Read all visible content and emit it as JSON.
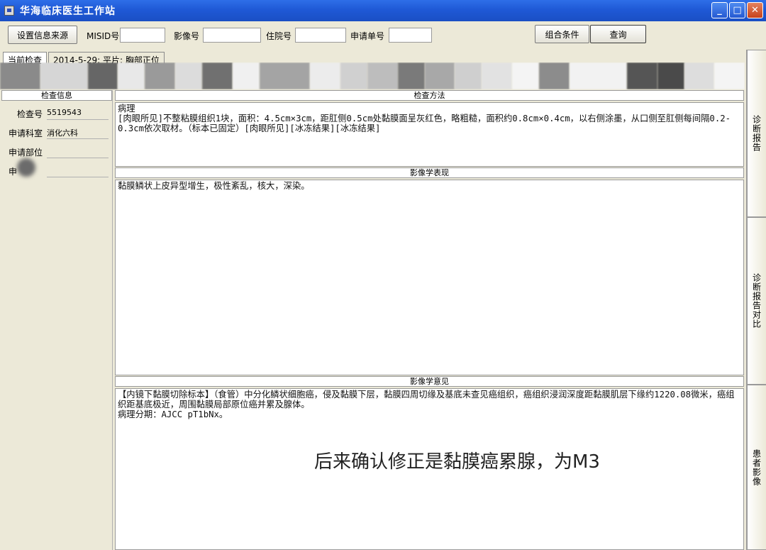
{
  "window": {
    "title": "华海临床医生工作站",
    "minimize": "_",
    "maximize": "□",
    "close": "✕"
  },
  "toolbar": {
    "settings_button": "设置信息来源",
    "misid_label": "MISID号",
    "image_no_label": "影像号",
    "inpatient_no_label": "住院号",
    "request_no_label": "申请单号",
    "misid_value": "",
    "image_no_value": "",
    "inpatient_no_value": "",
    "request_no_value": "",
    "combo_button": "组合条件",
    "query_button": "查询"
  },
  "tabs": {
    "current": "当前检查",
    "exam": "2014-5-29: 平片: 胸部正位"
  },
  "left_panel": {
    "header": "检查信息",
    "rows": [
      {
        "label": "检查号",
        "value": "5519543"
      },
      {
        "label": "申请科室",
        "value": "消化六科"
      },
      {
        "label": "申请部位",
        "value": ""
      },
      {
        "label": "申",
        "value": ""
      }
    ]
  },
  "main": {
    "method_header": "检查方法",
    "method_text": "病理\n[肉眼所见]不整粘膜组织1块，面积：4.5cm×3cm，距肛侧0.5cm处黏膜面呈灰红色，略粗糙，面积约0.8cm×0.4cm，以右侧涂墨，从口侧至肛侧每间隔0.2-0.3cm依次取材。（标本已固定）[肉眼所见][冰冻结果][冰冻结果]",
    "findings_header": "影像学表现",
    "findings_text": "黏膜鳞状上皮异型增生，极性紊乱，核大，深染。",
    "opinion_header": "影像学意见",
    "opinion_text": "【内镜下黏膜切除标本】（食管）中分化鳞状细胞癌，侵及黏膜下层，黏膜四周切缘及基底未查见癌组织，癌组织浸润深度距黏膜肌层下缘约1220.08微米，癌组织距基底极近，周围黏膜局部原位癌并累及腺体。\n病理分期：AJCC pT1bNx。",
    "overlay_note": "后来确认修正是黏膜癌累腺，为M3"
  },
  "right_tabs": [
    {
      "label": "诊断报告"
    },
    {
      "label": "诊断报告对比"
    },
    {
      "label": "患者影像"
    }
  ]
}
